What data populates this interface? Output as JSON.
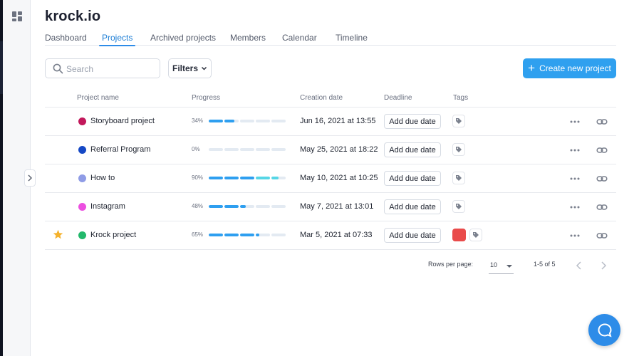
{
  "app": {
    "title": "krock.io"
  },
  "tabs": [
    {
      "label": "Dashboard",
      "active": false
    },
    {
      "label": "Projects",
      "active": true
    },
    {
      "label": "Archived projects",
      "active": false
    },
    {
      "label": "Members",
      "active": false
    },
    {
      "label": "Calendar",
      "active": false
    },
    {
      "label": "Timeline",
      "active": false
    }
  ],
  "toolbar": {
    "search_placeholder": "Search",
    "filters_label": "Filters",
    "create_label": "Create new project",
    "create_icon": "plus-icon"
  },
  "table": {
    "headers": {
      "name": "Project name",
      "progress": "Progress",
      "created": "Creation date",
      "deadline": "Deadline",
      "tags": "Tags"
    },
    "rows": [
      {
        "starred": false,
        "color": "#c2185b",
        "name": "Storyboard project",
        "progress_label": "34%",
        "progress": 0.34,
        "created": "Jun 16, 2021 at 13:55",
        "deadline": "Add due date",
        "tag_colors": []
      },
      {
        "starred": false,
        "color": "#1548c5",
        "name": "Referral Program",
        "progress_label": "0%",
        "progress": 0.0,
        "created": "May 25, 2021 at 18:22",
        "deadline": "Add due date",
        "tag_colors": []
      },
      {
        "starred": false,
        "color": "#8f9ce6",
        "name": "How to",
        "progress_label": "90%",
        "progress": 0.9,
        "created": "May 10, 2021 at 10:25",
        "deadline": "Add due date",
        "tag_colors": []
      },
      {
        "starred": false,
        "color": "#ec4fe0",
        "name": "Instagram",
        "progress_label": "48%",
        "progress": 0.48,
        "created": "May 7, 2021 at 13:01",
        "deadline": "Add due date",
        "tag_colors": []
      },
      {
        "starred": true,
        "color": "#22b86b",
        "name": "Krock project",
        "progress_label": "65%",
        "progress": 0.65,
        "created": "Mar 5, 2021 at 07:33",
        "deadline": "Add due date",
        "tag_colors": [
          "#e94b4b"
        ]
      }
    ]
  },
  "pagination": {
    "rows_per_page_label": "Rows per page:",
    "rows_per_page": "10",
    "range": "1-5 of 5"
  },
  "colors": {
    "accent": "#2fa0ef",
    "progress_fill": "#2e9ff0",
    "progress_fill_high": "#56d6e6",
    "progress_track": "#e3eaf2",
    "star": "#f5b22d"
  }
}
